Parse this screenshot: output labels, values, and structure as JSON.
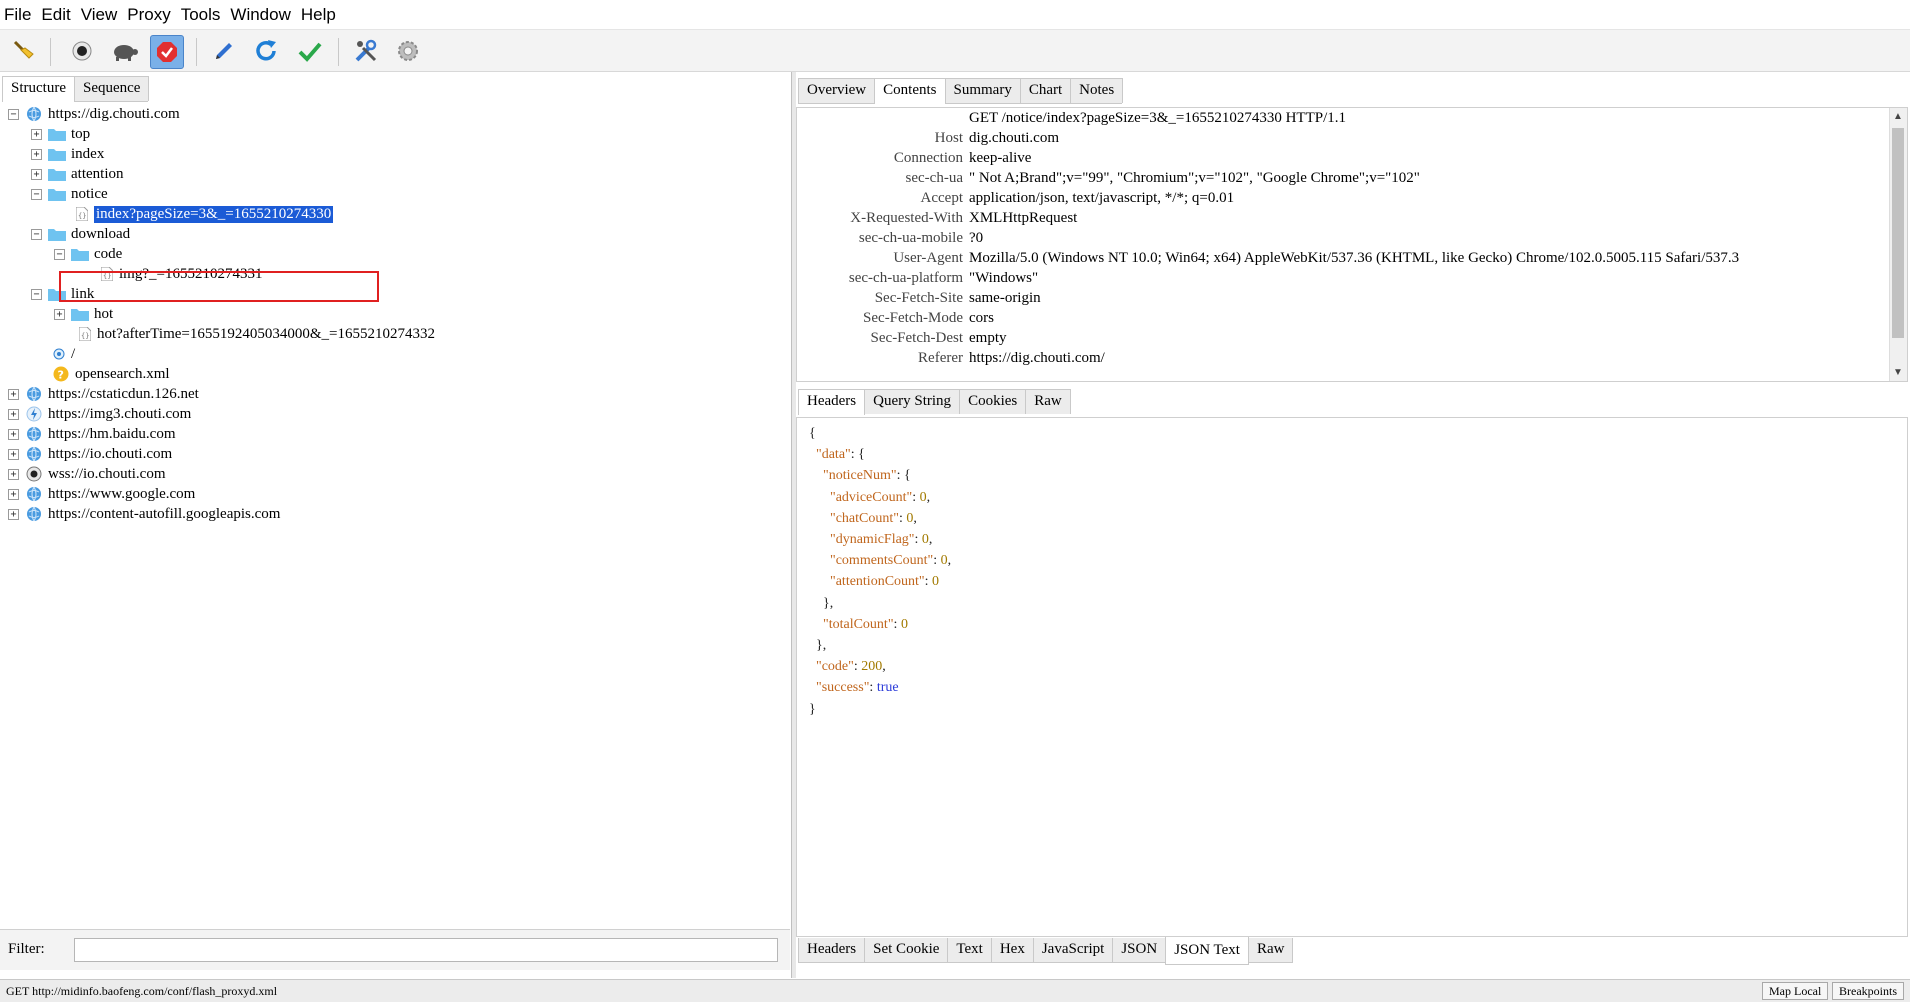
{
  "menu": [
    "File",
    "Edit",
    "View",
    "Proxy",
    "Tools",
    "Window",
    "Help"
  ],
  "left_tabs": [
    "Structure",
    "Sequence"
  ],
  "tree": [
    {
      "label": "https://dig.chouti.com",
      "expander": "−",
      "icon": "globe-icon"
    },
    {
      "label": "top",
      "expander": "+",
      "icon": "folder-icon"
    },
    {
      "label": "index",
      "expander": "+",
      "icon": "folder-icon"
    },
    {
      "label": "attention",
      "expander": "+",
      "icon": "folder-icon"
    },
    {
      "label": "notice",
      "expander": "−",
      "icon": "folder-icon"
    },
    {
      "label": "index?pageSize=3&_=1655210274330",
      "icon": "json-file-icon"
    },
    {
      "label": "download",
      "expander": "−",
      "icon": "folder-icon"
    },
    {
      "label": "code",
      "expander": "−",
      "icon": "folder-icon"
    },
    {
      "label": "img?_=1655210274331",
      "icon": "json-file-icon"
    },
    {
      "label": "link",
      "expander": "−",
      "icon": "folder-icon"
    },
    {
      "label": "hot",
      "expander": "+",
      "icon": "folder-icon"
    },
    {
      "label": "hot?afterTime=1655192405034000&_=1655210274332",
      "icon": "json-file-icon"
    },
    {
      "label": "/",
      "icon": "settings-file-icon"
    },
    {
      "label": "opensearch.xml",
      "icon": "question-icon"
    },
    {
      "label": "https://cstaticdun.126.net",
      "expander": "+",
      "icon": "globe-icon"
    },
    {
      "label": "https://img3.chouti.com",
      "expander": "+",
      "icon": "lightning-icon"
    },
    {
      "label": "https://hm.baidu.com",
      "expander": "+",
      "icon": "globe-icon"
    },
    {
      "label": "https://io.chouti.com",
      "expander": "+",
      "icon": "globe-icon"
    },
    {
      "label": "wss://io.chouti.com",
      "expander": "+",
      "icon": "websocket-icon"
    },
    {
      "label": "https://www.google.com",
      "expander": "+",
      "icon": "globe-icon"
    },
    {
      "label": "https://content-autofill.googleapis.com",
      "expander": "+",
      "icon": "globe-icon"
    }
  ],
  "filter": {
    "label": "Filter:",
    "value": ""
  },
  "right_tabs": [
    "Overview",
    "Contents",
    "Summary",
    "Chart",
    "Notes"
  ],
  "request": {
    "request_line": "GET /notice/index?pageSize=3&_=1655210274330 HTTP/1.1",
    "headers": [
      {
        "key": "Host",
        "value": "dig.chouti.com"
      },
      {
        "key": "Connection",
        "value": "keep-alive"
      },
      {
        "key": "sec-ch-ua",
        "value": "\" Not A;Brand\";v=\"99\", \"Chromium\";v=\"102\", \"Google Chrome\";v=\"102\""
      },
      {
        "key": "Accept",
        "value": "application/json, text/javascript, */*; q=0.01"
      },
      {
        "key": "X-Requested-With",
        "value": "XMLHttpRequest"
      },
      {
        "key": "sec-ch-ua-mobile",
        "value": "?0"
      },
      {
        "key": "User-Agent",
        "value": "Mozilla/5.0 (Windows NT 10.0; Win64; x64) AppleWebKit/537.36 (KHTML, like Gecko) Chrome/102.0.5005.115 Safari/537.3"
      },
      {
        "key": "sec-ch-ua-platform",
        "value": "\"Windows\""
      },
      {
        "key": "Sec-Fetch-Site",
        "value": "same-origin"
      },
      {
        "key": "Sec-Fetch-Mode",
        "value": "cors"
      },
      {
        "key": "Sec-Fetch-Dest",
        "value": "empty"
      },
      {
        "key": "Referer",
        "value": "https://dig.chouti.com/"
      }
    ]
  },
  "request_tabs": [
    "Headers",
    "Query String",
    "Cookies",
    "Raw"
  ],
  "response_lines": [
    {
      "indent": "",
      "parts": [
        [
          "p",
          "{"
        ]
      ]
    },
    {
      "indent": "  ",
      "parts": [
        [
          "k",
          "\"data\""
        ],
        [
          "p",
          ": {"
        ]
      ]
    },
    {
      "indent": "    ",
      "parts": [
        [
          "k",
          "\"noticeNum\""
        ],
        [
          "p",
          ": {"
        ]
      ]
    },
    {
      "indent": "      ",
      "parts": [
        [
          "k",
          "\"adviceCount\""
        ],
        [
          "p",
          ": "
        ],
        [
          "n",
          "0"
        ],
        [
          "p",
          ","
        ]
      ]
    },
    {
      "indent": "      ",
      "parts": [
        [
          "k",
          "\"chatCount\""
        ],
        [
          "p",
          ": "
        ],
        [
          "n",
          "0"
        ],
        [
          "p",
          ","
        ]
      ]
    },
    {
      "indent": "      ",
      "parts": [
        [
          "k",
          "\"dynamicFlag\""
        ],
        [
          "p",
          ": "
        ],
        [
          "n",
          "0"
        ],
        [
          "p",
          ","
        ]
      ]
    },
    {
      "indent": "      ",
      "parts": [
        [
          "k",
          "\"commentsCount\""
        ],
        [
          "p",
          ": "
        ],
        [
          "n",
          "0"
        ],
        [
          "p",
          ","
        ]
      ]
    },
    {
      "indent": "      ",
      "parts": [
        [
          "k",
          "\"attentionCount\""
        ],
        [
          "p",
          ": "
        ],
        [
          "n",
          "0"
        ]
      ]
    },
    {
      "indent": "    ",
      "parts": [
        [
          "p",
          "},"
        ]
      ]
    },
    {
      "indent": "    ",
      "parts": [
        [
          "k",
          "\"totalCount\""
        ],
        [
          "p",
          ": "
        ],
        [
          "n",
          "0"
        ]
      ]
    },
    {
      "indent": "  ",
      "parts": [
        [
          "p",
          "},"
        ]
      ]
    },
    {
      "indent": "  ",
      "parts": [
        [
          "k",
          "\"code\""
        ],
        [
          "p",
          ": "
        ],
        [
          "n",
          "200"
        ],
        [
          "p",
          ","
        ]
      ]
    },
    {
      "indent": "  ",
      "parts": [
        [
          "k",
          "\"success\""
        ],
        [
          "p",
          ": "
        ],
        [
          "b",
          "true"
        ]
      ]
    },
    {
      "indent": "",
      "parts": [
        [
          "p",
          "}"
        ]
      ]
    }
  ],
  "response_tabs": [
    "Headers",
    "Set Cookie",
    "Text",
    "Hex",
    "JavaScript",
    "JSON",
    "JSON Text",
    "Raw"
  ],
  "status": {
    "text": "GET http://midinfo.baofeng.com/conf/flash_proxyd.xml",
    "map_local": "Map Local",
    "breakpoints": "Breakpoints"
  },
  "colors": {
    "selection": "#1b5bd6",
    "highlight_box": "#e02020",
    "json_key": "#c0661d",
    "json_number": "#a27a00",
    "json_bool": "#2b3bd9"
  }
}
